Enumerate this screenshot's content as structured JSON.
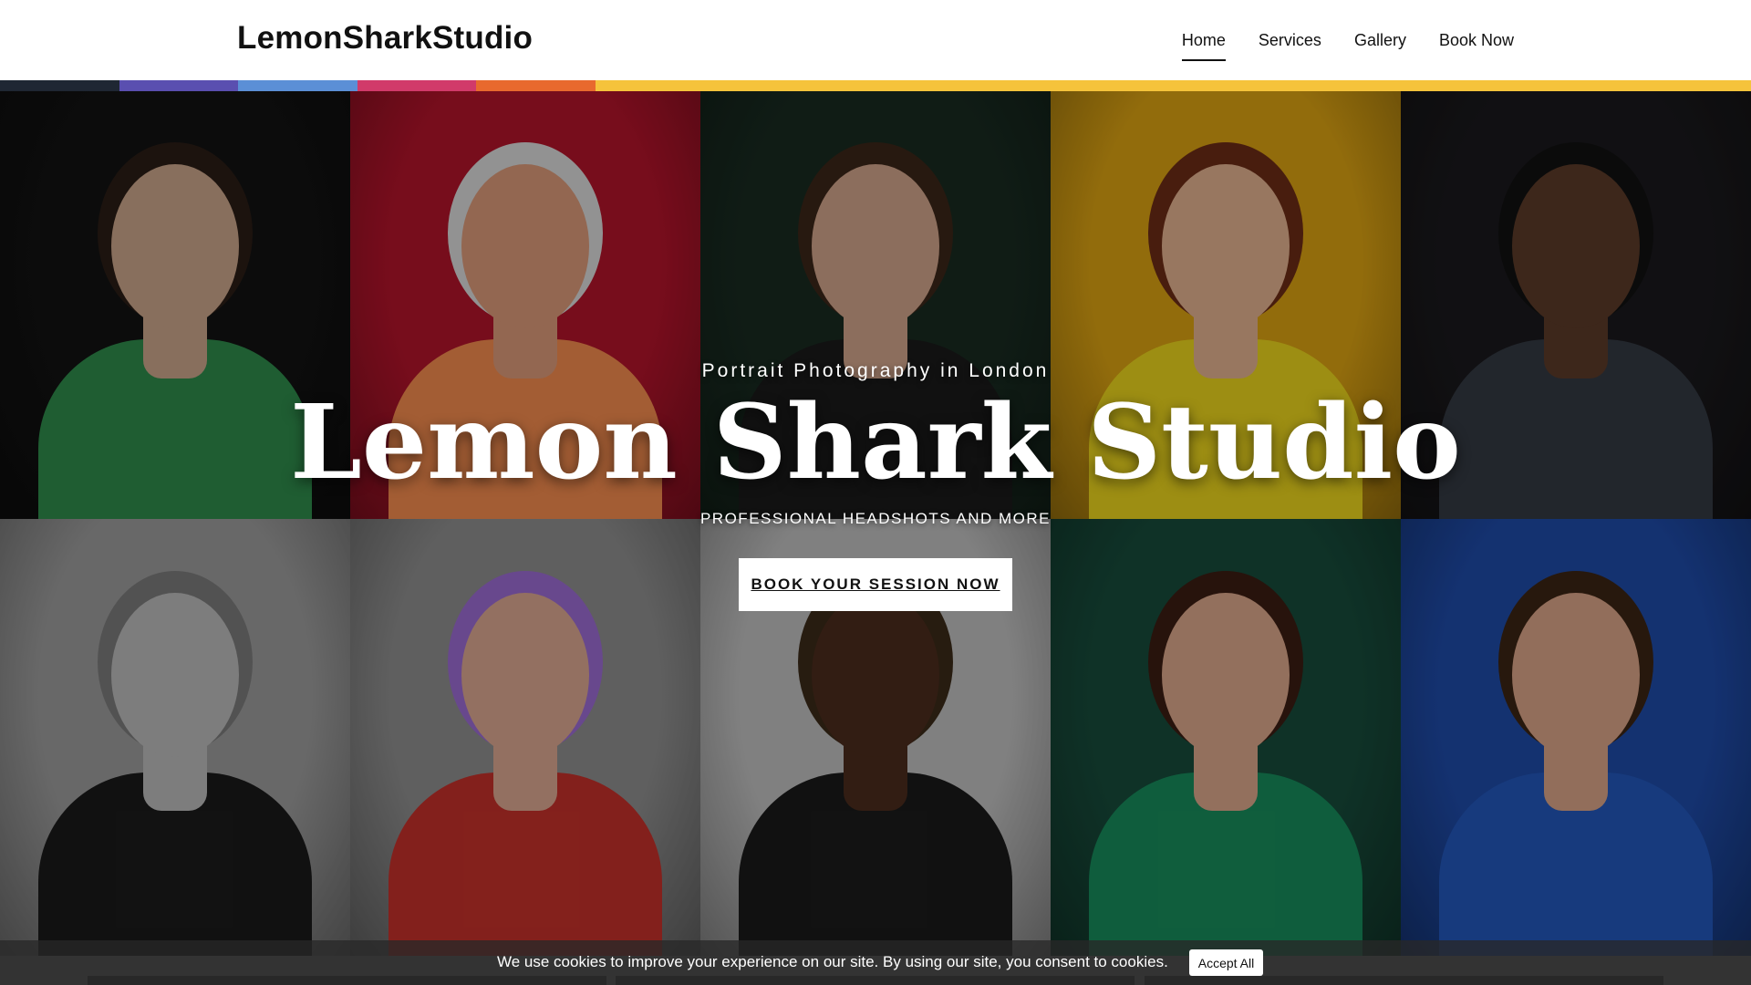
{
  "header": {
    "logo": "LemonSharkStudio",
    "nav": [
      {
        "label": "Home",
        "active": true
      },
      {
        "label": "Services",
        "active": false
      },
      {
        "label": "Gallery",
        "active": false
      },
      {
        "label": "Book Now",
        "active": false
      }
    ]
  },
  "stripe_colors": [
    "#1f2733",
    "#5a4fb0",
    "#5b8fd6",
    "#d13a6a",
    "#e8692e",
    "#f5c33b"
  ],
  "hero": {
    "kicker": "Portrait Photography in London",
    "title": "Lemon Shark Studio",
    "subtitle": "PROFESSIONAL HEADSHOTS AND MORE",
    "cta_label": "BOOK YOUR SESSION NOW"
  },
  "gallery_tiles": [
    {
      "name": "portrait-1",
      "bg": "#121212",
      "skin": "#c9a48a",
      "clothing": "#2e8a4b",
      "hair": "#2a1d16"
    },
    {
      "name": "portrait-2",
      "bg": "#b0142a",
      "skin": "#d99878",
      "clothing": "#f08a4d",
      "hair": "#d8d8d8"
    },
    {
      "name": "portrait-3",
      "bg": "#182a20",
      "skin": "#cfa28a",
      "clothing": "#1a1a1a",
      "hair": "#3a2618"
    },
    {
      "name": "portrait-4",
      "bg": "#d79f12",
      "skin": "#e0b08e",
      "clothing": "#e8d21c",
      "hair": "#6a2b16"
    },
    {
      "name": "portrait-5",
      "bg": "#1a191c",
      "skin": "#5a3a28",
      "clothing": "#333842",
      "hair": "#111111"
    },
    {
      "name": "portrait-6",
      "bg": "#9a9a9a",
      "skin": "#b8b8b8",
      "clothing": "#1a1a1a",
      "hair": "#7a7a7a"
    },
    {
      "name": "portrait-7",
      "bg": "#8c8c8c",
      "skin": "#d9a690",
      "clothing": "#c2302a",
      "hair": "#9a6ad0"
    },
    {
      "name": "portrait-8",
      "bg": "#bdbdbd",
      "skin": "#4a2c1c",
      "clothing": "#1a1a1a",
      "hair": "#3a2a18"
    },
    {
      "name": "portrait-9",
      "bg": "#174a3a",
      "skin": "#d9a58a",
      "clothing": "#178a5a",
      "hair": "#3a1c12"
    },
    {
      "name": "portrait-10",
      "bg": "#1e4aa6",
      "skin": "#d8a286",
      "clothing": "#2256b8",
      "hair": "#3a2414"
    }
  ],
  "cookie": {
    "text": "We use cookies to improve your experience on our site. By using our site, you consent to cookies.",
    "button_label": "Accept All"
  }
}
